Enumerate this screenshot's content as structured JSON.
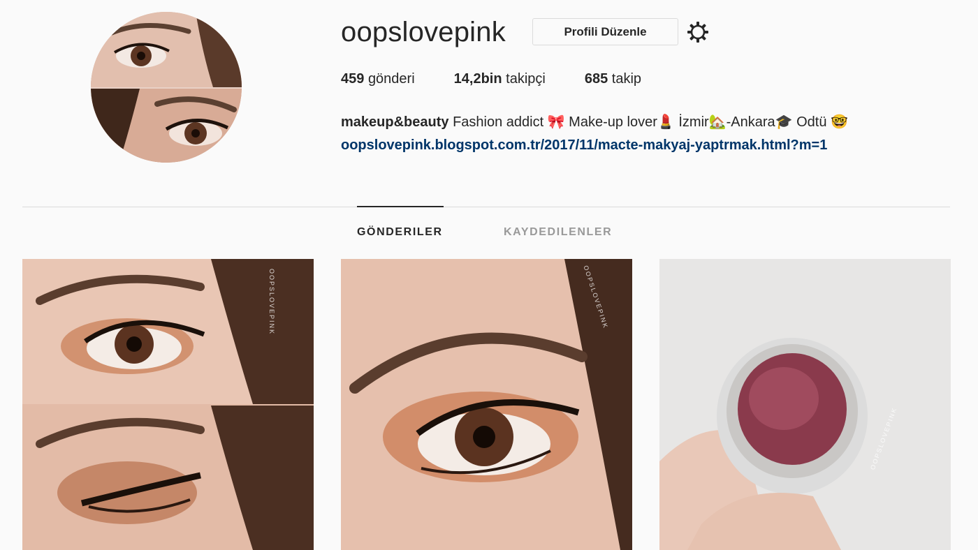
{
  "profile": {
    "username": "oopslovepink",
    "edit_button": "Profili Düzenle",
    "settings_icon": "gear-icon"
  },
  "stats": {
    "posts_count": "459",
    "posts_label": "gönderi",
    "followers_count": "14,2bin",
    "followers_label": "takipçi",
    "following_count": "685",
    "following_label": "takip"
  },
  "bio": {
    "name": "makeup&beauty",
    "part1": "Fashion addict",
    "emoji_bow": "🎀",
    "part2": "Make-up lover",
    "emoji_lipstick": "💄",
    "part3": "İzmir",
    "emoji_house": "🏡",
    "part4": "-Ankara",
    "emoji_cap": "🎓",
    "part5": "Odtü",
    "emoji_nerd": "🤓",
    "link": "oopslovepink.blogspot.com.tr/2017/11/macte-makyaj-yaptrmak.html?m=1"
  },
  "tabs": {
    "posts": "GÖNDERILER",
    "saved": "KAYDEDILENLER"
  },
  "posts": [
    {
      "watermark": "OOPSLOVEPINK"
    },
    {
      "watermark": "OOPSLOVEPINK"
    },
    {
      "watermark": "OOPSLOVEPINK"
    }
  ],
  "colors": {
    "link": "#003569",
    "text": "#262626",
    "muted_tab": "#999999",
    "divider": "#dbdbdb",
    "background": "#fafafa"
  }
}
